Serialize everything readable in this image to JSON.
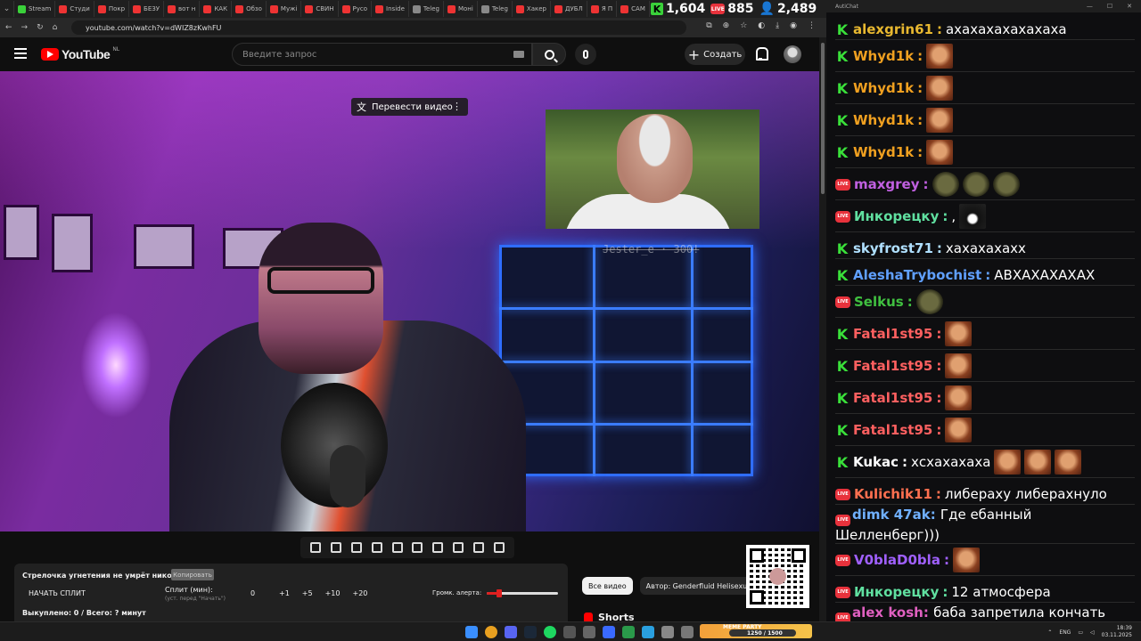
{
  "browser": {
    "tabs": [
      "Stream",
      "Студи",
      "Покр",
      "БЕЗУ",
      "вот н",
      "КАК",
      "Обзо",
      "Мужі",
      "СВИН",
      "Русо",
      "Inside",
      "Teleg",
      "Моні",
      "Teleg",
      "Хакер",
      "ДУБЛ",
      "Я П",
      "САМ"
    ],
    "url": "youtube.com/watch?v=dWIZ8zKwhFU"
  },
  "stats": {
    "kick_viewers": "1,604",
    "live_viewers": "885",
    "total_viewers": "2,489"
  },
  "youtube": {
    "logo": "YouTube",
    "logo_region": "NL",
    "search_placeholder": "Введите запрос",
    "create_label": "Создать",
    "translate_label": "Перевести видео",
    "overlay_text": "Jester_e · 300!"
  },
  "split_panel": {
    "title": "Стрелочка угнетения не умрёт никогда",
    "copy_label": "Копировать",
    "start_label": "НАЧАТЬ СПЛИТ",
    "split_label": "Сплит (мин):",
    "split_hint": "(уст. перед \"Начать\")",
    "split_value": "0",
    "increments": [
      "+1",
      "+5",
      "+10",
      "+20"
    ],
    "alert_label": "Громк. алерта:",
    "alert_volume": 0.18,
    "footer": "Выкуплено: 0 / Всего: ? минут"
  },
  "chips": [
    "Все видео",
    "Автор: Genderfluid Helisexua"
  ],
  "shorts_label": "Shorts",
  "chat": {
    "title": "AutiChat",
    "messages": [
      {
        "platform": "kick",
        "user": "alexgrin61",
        "color": "#e8b830",
        "text": "ахахахахахахаха",
        "emotes": []
      },
      {
        "platform": "kick",
        "user": "Whyd1k",
        "color": "#f0a020",
        "text": "",
        "emotes": [
          "face"
        ]
      },
      {
        "platform": "kick",
        "user": "Whyd1k",
        "color": "#f0a020",
        "text": "",
        "emotes": [
          "face"
        ]
      },
      {
        "platform": "kick",
        "user": "Whyd1k",
        "color": "#f0a020",
        "text": "",
        "emotes": [
          "face"
        ]
      },
      {
        "platform": "kick",
        "user": "Whyd1k",
        "color": "#f0a020",
        "text": "",
        "emotes": [
          "face"
        ]
      },
      {
        "platform": "live",
        "user": "maxgrey",
        "color": "#c060e0",
        "text": "",
        "emotes": [
          "frog",
          "frog",
          "frog"
        ]
      },
      {
        "platform": "live",
        "user": "Инкорецку",
        "color": "#60e0a0",
        "text": ",",
        "emotes": [
          "dark"
        ]
      },
      {
        "platform": "kick",
        "user": "skyfrost71",
        "color": "#b0e0ff",
        "text": "хахахахахх",
        "emotes": []
      },
      {
        "platform": "kick",
        "user": "AleshaTrybochist",
        "color": "#60a0ff",
        "text": "АВХАХАХАХАХ",
        "emotes": []
      },
      {
        "platform": "live",
        "user": "Selkus",
        "color": "#40c040",
        "text": "",
        "emotes": [
          "frog"
        ]
      },
      {
        "platform": "kick",
        "user": "Fatal1st95",
        "color": "#ff6060",
        "text": "",
        "emotes": [
          "face"
        ]
      },
      {
        "platform": "kick",
        "user": "Fatal1st95",
        "color": "#ff6060",
        "text": "",
        "emotes": [
          "face"
        ]
      },
      {
        "platform": "kick",
        "user": "Fatal1st95",
        "color": "#ff6060",
        "text": "",
        "emotes": [
          "face"
        ]
      },
      {
        "platform": "kick",
        "user": "Fatal1st95",
        "color": "#ff6060",
        "text": "",
        "emotes": [
          "face"
        ]
      },
      {
        "platform": "kick",
        "user": "Kukac",
        "color": "#ffffff",
        "text": "хсхахахаха",
        "emotes": [
          "face",
          "face",
          "face"
        ]
      },
      {
        "platform": "live",
        "user": "Kulichik11",
        "color": "#ff7050",
        "text": "либераху либерахнуло",
        "emotes": []
      },
      {
        "platform": "live",
        "user": "dimk 47ak",
        "color": "#70b0ff",
        "text": "Где ебанный Шелленберг)))",
        "emotes": []
      },
      {
        "platform": "live",
        "user": "V0blaD0bla",
        "color": "#a060ff",
        "text": "",
        "emotes": [
          "face"
        ]
      },
      {
        "platform": "live",
        "user": "Инкорецку",
        "color": "#60e0a0",
        "text": "12 атмосфера",
        "emotes": []
      },
      {
        "platform": "live",
        "user": "alex kosh",
        "color": "#e060c0",
        "text": "баба запретила кончать",
        "emotes": []
      }
    ]
  },
  "taskbar": {
    "meme_title": "MEME PARTY",
    "meme_value": "1250 / 1500",
    "lang": "ENG",
    "time": "18:39",
    "date": "03.11.2025"
  }
}
